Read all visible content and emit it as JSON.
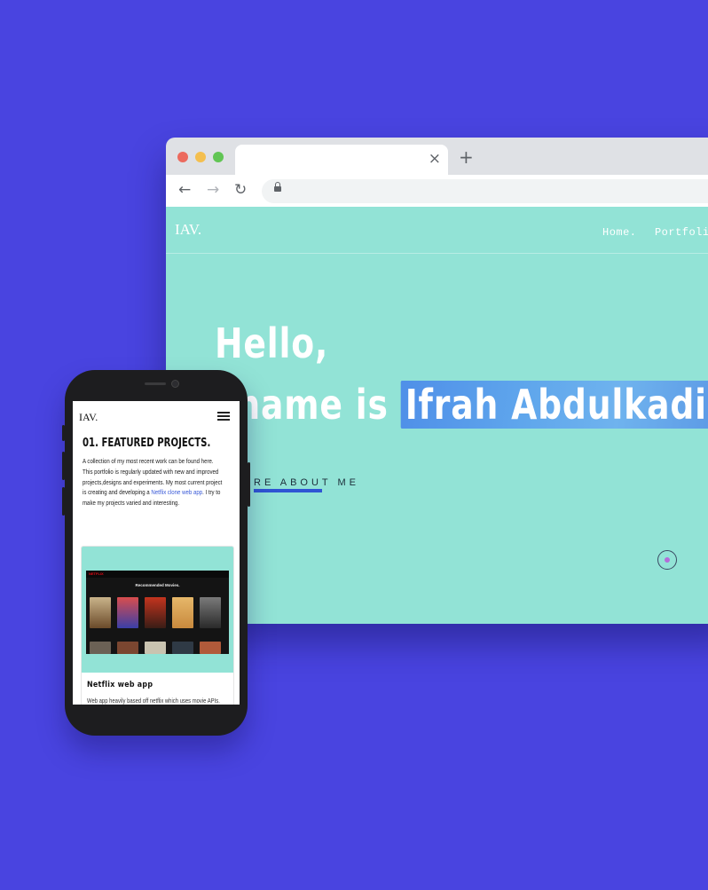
{
  "browser": {
    "tab_close": "×",
    "new_tab": "+",
    "back": "←",
    "forward": "→",
    "reload": "↻"
  },
  "site": {
    "logo": "IAV.",
    "nav": [
      "Home.",
      "Portfolio"
    ],
    "hero_line1": "Hello,",
    "hero_line2_prefix": "y name is",
    "hero_highlight": "Ifrah Abdulkadi",
    "cta": "RE ABOUT ME",
    "colors": {
      "background": "#92e3d6",
      "highlight": "#5fa6ec",
      "underline": "#2f55d4",
      "page": "#4944e0"
    }
  },
  "mobile": {
    "logo": "IAV.",
    "section_title": "01. FEATURED PROJECTS.",
    "description_before_link": "A collection of my most recent work can be found here. This portfolio is regularly updated with new and improved projects,designs and experiments. My most current project is creating and developing a ",
    "link_text": "Netflix clone web app",
    "description_after_link": ". I try to make my projects varied and interesting.",
    "card": {
      "screenshot_heading": "Recommended Movies.",
      "screenshot_logo": "NETFLIX",
      "title": "Netflix web app",
      "description": "Web app heavily based off netflix which uses movie APIs."
    }
  }
}
